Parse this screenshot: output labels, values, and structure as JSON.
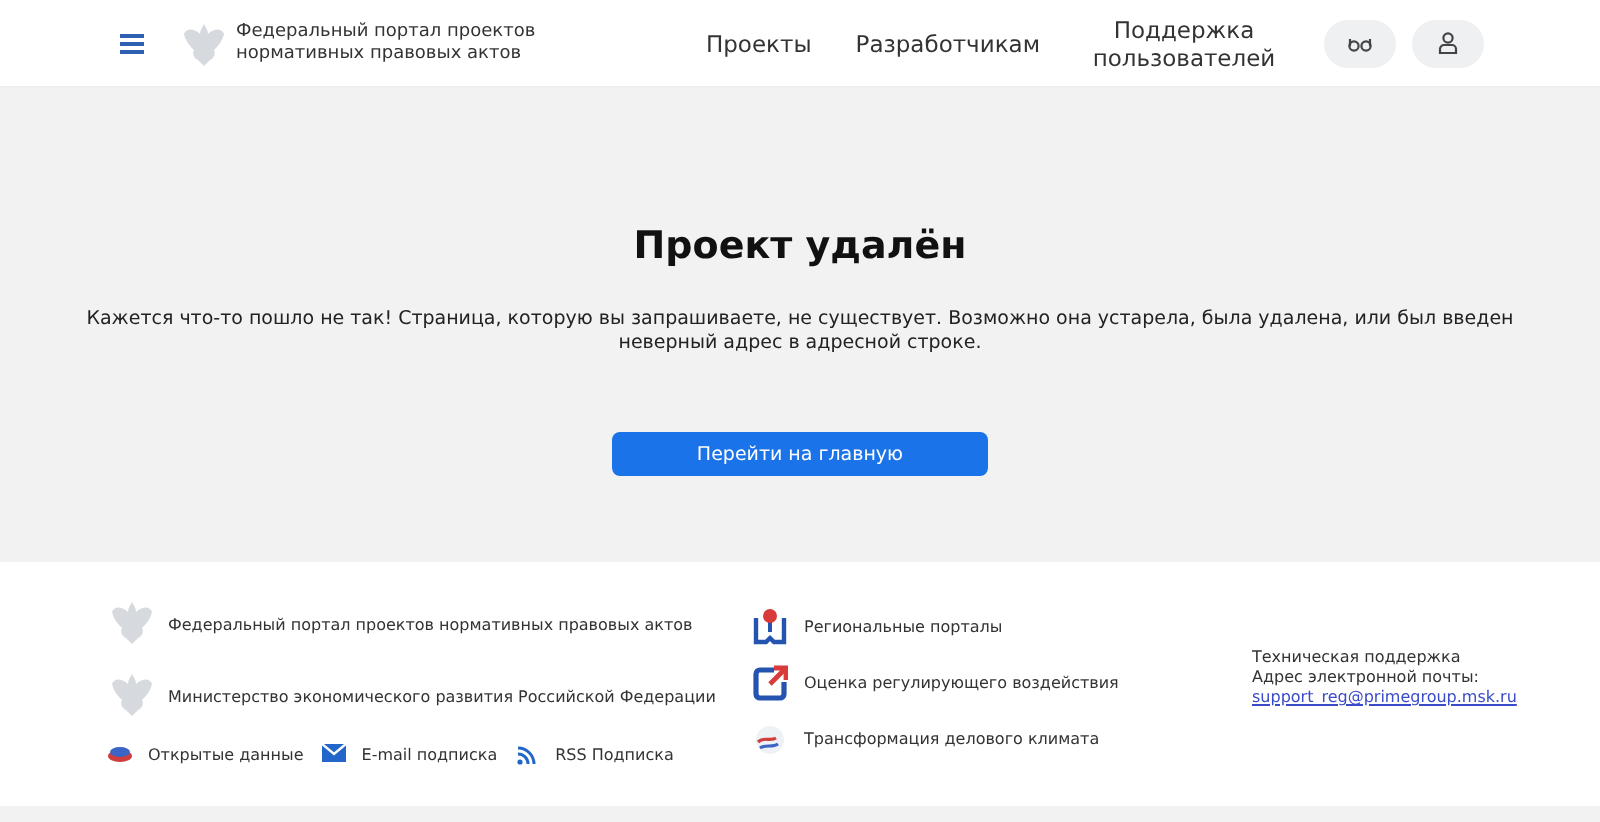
{
  "header": {
    "logo_text": "Федеральный портал проектов нормативных правовых актов",
    "nav": [
      {
        "label": "Проекты"
      },
      {
        "label": "Разработчикам"
      },
      {
        "label": "Поддержка пользователей"
      }
    ]
  },
  "main": {
    "title": "Проект удалён",
    "message": "Кажется что-то пошло не так! Страница, которую вы запрашиваете, не существует. Возможно она устарела, была удалена, или был введен неверный адрес в адресной строке.",
    "button": "Перейти на главную"
  },
  "footer": {
    "orgs": [
      {
        "label": "Федеральный портал проектов нормативных правовых актов"
      },
      {
        "label": "Министерство экономического развития Российской Федерации"
      }
    ],
    "links": [
      {
        "kind": "data",
        "label": "Открытые данные"
      },
      {
        "kind": "mail",
        "label": "E-mail подписка"
      },
      {
        "kind": "rss",
        "label": "RSS Подписка"
      }
    ],
    "portals": [
      {
        "kind": "regional",
        "label": "Региональные порталы"
      },
      {
        "kind": "assessment",
        "label": "Оценка регулирующего воздействия"
      },
      {
        "kind": "climate",
        "label": "Трансформация делового климата"
      }
    ],
    "support": {
      "title": "Техническая поддержка",
      "email_label": "Адрес электронной почты:",
      "email": "support_reg@primegroup.msk.ru"
    }
  }
}
